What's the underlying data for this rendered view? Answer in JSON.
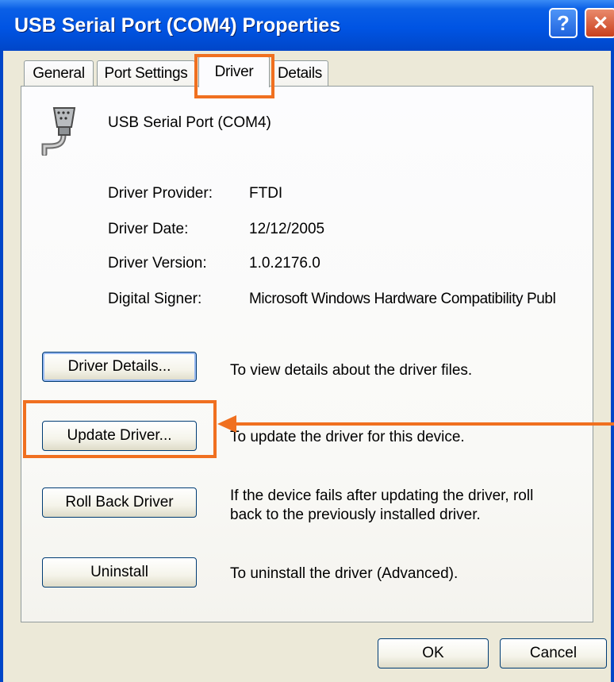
{
  "window": {
    "title": "USB Serial Port (COM4) Properties",
    "help_glyph": "?",
    "close_glyph": "✕"
  },
  "tabs": [
    {
      "label": "General"
    },
    {
      "label": "Port Settings"
    },
    {
      "label": "Driver",
      "active": true
    },
    {
      "label": "Details"
    }
  ],
  "device": {
    "icon": "serial-port-icon",
    "name": "USB Serial Port (COM4)"
  },
  "driver_info": [
    {
      "label": "Driver Provider:",
      "value": "FTDI"
    },
    {
      "label": "Driver Date:",
      "value": "12/12/2005"
    },
    {
      "label": "Driver Version:",
      "value": "1.0.2176.0"
    },
    {
      "label": "Digital Signer:",
      "value": "Microsoft Windows Hardware Compatibility Publ"
    }
  ],
  "actions": [
    {
      "button": "Driver Details...",
      "mnemonic": "D",
      "description": "To view details about the driver files."
    },
    {
      "button": "Update Driver...",
      "mnemonic": "p",
      "description": "To update the driver for this device."
    },
    {
      "button": "Roll Back Driver",
      "mnemonic": "R",
      "description_line1": "If the device fails after updating the driver, roll",
      "description_line2": "back to the previously installed driver."
    },
    {
      "button": "Uninstall",
      "mnemonic": "U",
      "description": "To uninstall the driver (Advanced)."
    }
  ],
  "footer": {
    "ok": "OK",
    "cancel": "Cancel"
  },
  "colors": {
    "highlight": "#f07020",
    "titlebar": "#0054e3"
  }
}
